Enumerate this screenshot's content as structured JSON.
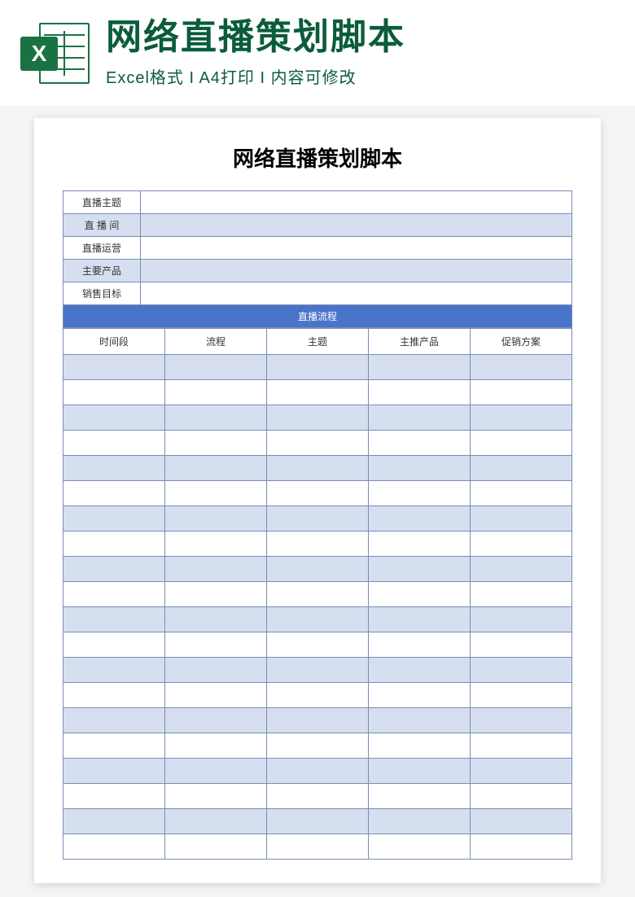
{
  "banner": {
    "title": "网络直播策划脚本",
    "subtitle": "Excel格式 I A4打印 I 内容可修改",
    "icon_letter": "X"
  },
  "document": {
    "title": "网络直播策划脚本",
    "info_rows": [
      {
        "label": "直播主题",
        "value": ""
      },
      {
        "label": "直 播 间",
        "value": ""
      },
      {
        "label": "直播运营",
        "value": ""
      },
      {
        "label": "主要产品",
        "value": ""
      },
      {
        "label": "销售目标",
        "value": ""
      }
    ],
    "section_header": "直播流程",
    "flow_headers": [
      "时间段",
      "流程",
      "主题",
      "主推产品",
      "促销方案"
    ],
    "flow_row_count": 20
  }
}
